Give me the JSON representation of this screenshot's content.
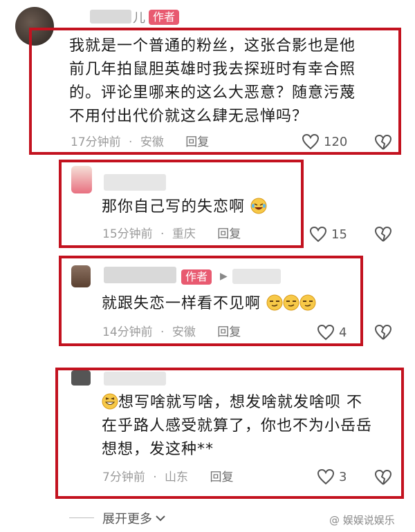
{
  "comments": [
    {
      "author_tag": "作者",
      "text_lines": [
        "我就是一个普通的粉丝，这张合影也是他",
        "前几年拍鼠胆英雄时我去探班时有幸合照",
        "的。评论里哪来的这么大恶意？随意污蔑",
        "不用付出代价就这么肆无忌惮吗？"
      ],
      "time": "17分钟前",
      "location": "安徽",
      "reply": "回复",
      "likes": "120"
    },
    {
      "text": "那你自己写的失恋啊",
      "time": "15分钟前",
      "location": "重庆",
      "reply": "回复",
      "likes": "15"
    },
    {
      "author_tag": "作者",
      "text": "就跟失恋一样看不见啊",
      "time": "14分钟前",
      "location": "安徽",
      "reply": "回复",
      "likes": "4"
    },
    {
      "text_lines": [
        "想写啥就写啥，想发啥就发啥呗 不",
        "在乎路人感受就算了，你也不为小岳岳",
        "想想，发这种**"
      ],
      "time": "7分钟前",
      "location": "山东",
      "reply": "回复",
      "likes": "3"
    }
  ],
  "expand_more": "展开更多",
  "watermark": "@ 娱娱说娱乐",
  "separator": "·",
  "icons": {
    "like": "heart-outline-icon",
    "dislike": "broken-heart-icon",
    "expand": "chevron-down-icon"
  },
  "colors": {
    "highlight_box": "#c3121f",
    "author_tag": "#e85a70"
  }
}
